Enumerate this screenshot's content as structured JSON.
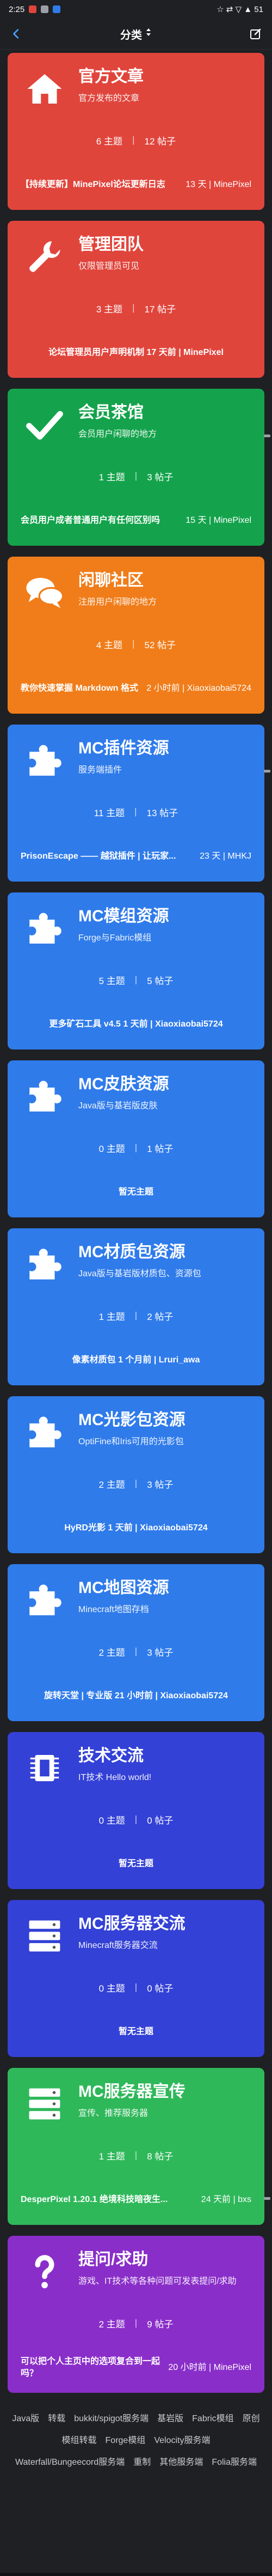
{
  "status_bar": {
    "time": "2:25",
    "right_text": "☆ ⇄ ▽ ▲ 51"
  },
  "header": {
    "title": "分类",
    "sort_icon": "sort-arrows-icon",
    "back_icon": "chevron-left-icon",
    "compose_icon": "compose-icon"
  },
  "categories": [
    {
      "name": "官方文章",
      "desc": "官方发布的文章",
      "topics": "6 主题",
      "posts": "12 帖子",
      "latest_title": "【持续更新】MinePixel论坛更新日志",
      "latest_meta": "13 天 | MinePixel",
      "color": "#e0453c",
      "icon": "home-icon"
    },
    {
      "name": "管理团队",
      "desc": "仅限管理员可见",
      "topics": "3 主题",
      "posts": "17 帖子",
      "latest_title": "论坛管理员用户声明机制 17 天前 | MinePixel",
      "latest_meta": "",
      "color": "#e0453c",
      "icon": "wrench-icon"
    },
    {
      "name": "会员茶馆",
      "desc": "会员用户闲聊的地方",
      "topics": "1 主题",
      "posts": "3 帖子",
      "latest_title": "会员用户成者普通用户有任何区别吗",
      "latest_meta": "15 天 | MinePixel",
      "color": "#14a34c",
      "icon": "checkmark-icon"
    },
    {
      "name": "闲聊社区",
      "desc": "注册用户闲聊的地方",
      "topics": "4 主题",
      "posts": "52 帖子",
      "latest_title": "教你快速掌握 Markdown 格式",
      "latest_meta": "2 小时前 | Xiaoxiaobai5724",
      "color": "#f07d1a",
      "icon": "chat-bubbles-icon"
    },
    {
      "name": "MC插件资源",
      "desc": "服务端插件",
      "topics": "11 主题",
      "posts": "13 帖子",
      "latest_title": "PrisonEscape —— 越狱插件 | 让玩家...",
      "latest_meta": "23 天 | MHKJ",
      "color": "#2f7bea",
      "icon": "puzzle-icon"
    },
    {
      "name": "MC模组资源",
      "desc": "Forge与Fabric模组",
      "topics": "5 主题",
      "posts": "5 帖子",
      "latest_title": "更多矿石工具 v4.5 1 天前 | Xiaoxiaobai5724",
      "latest_meta": "",
      "color": "#2f7bea",
      "icon": "puzzle-icon"
    },
    {
      "name": "MC皮肤资源",
      "desc": "Java版与基岩版皮肤",
      "topics": "0 主题",
      "posts": "1 帖子",
      "latest_title": "暂无主题",
      "latest_meta": "",
      "color": "#2f7bea",
      "icon": "puzzle-icon"
    },
    {
      "name": "MC材质包资源",
      "desc": "Java版与基岩版材质包、资源包",
      "topics": "1 主题",
      "posts": "2 帖子",
      "latest_title": "像素材质包 1 个月前 | Lruri_awa",
      "latest_meta": "",
      "color": "#2f7bea",
      "icon": "puzzle-icon"
    },
    {
      "name": "MC光影包资源",
      "desc": "OptiFine和Iris可用的光影包",
      "topics": "2 主题",
      "posts": "3 帖子",
      "latest_title": "HyRD光影 1 天前 | Xiaoxiaobai5724",
      "latest_meta": "",
      "color": "#2f7bea",
      "icon": "puzzle-icon"
    },
    {
      "name": "MC地图资源",
      "desc": "Minecraft地图存档",
      "topics": "2 主题",
      "posts": "3 帖子",
      "latest_title": "旋转天堂 | 专业版 21 小时前 | Xiaoxiaobai5724",
      "latest_meta": "",
      "color": "#2f7bea",
      "icon": "puzzle-icon"
    },
    {
      "name": "技术交流",
      "desc": "IT技术 Hello world!",
      "topics": "0 主题",
      "posts": "0 帖子",
      "latest_title": "暂无主题",
      "latest_meta": "",
      "color": "#3341d6",
      "icon": "chip-icon"
    },
    {
      "name": "MC服务器交流",
      "desc": "Minecraft服务器交流",
      "topics": "0 主题",
      "posts": "0 帖子",
      "latest_title": "暂无主题",
      "latest_meta": "",
      "color": "#3341d6",
      "icon": "server-icon"
    },
    {
      "name": "MC服务器宣传",
      "desc": "宣传、推荐服务器",
      "topics": "1 主题",
      "posts": "8 帖子",
      "latest_title": "DesperPixel 1.20.1 绝境科技暗夜生...",
      "latest_meta": "24 天前 | bxs",
      "color": "#2fb85a",
      "icon": "server-icon"
    },
    {
      "name": "提问/求助",
      "desc": "游戏、IT技术等各种问题可发表提问/求助",
      "topics": "2 主题",
      "posts": "9 帖子",
      "latest_title": "可以把个人主页中的选项复合到一起吗？",
      "latest_meta": "20 小时前 | MinePixel",
      "color": "#8a2ec9",
      "icon": "question-mark-icon"
    }
  ],
  "footer_links": [
    "Java版",
    "转载",
    "bukkit/spigot服务端",
    "基岩版",
    "Fabric模组",
    "原创",
    "模组转载",
    "Forge模组",
    "Velocity服务端",
    "Waterfall/Bungeecord服务端",
    "重制",
    "其他服务端",
    "Folia服务端"
  ]
}
